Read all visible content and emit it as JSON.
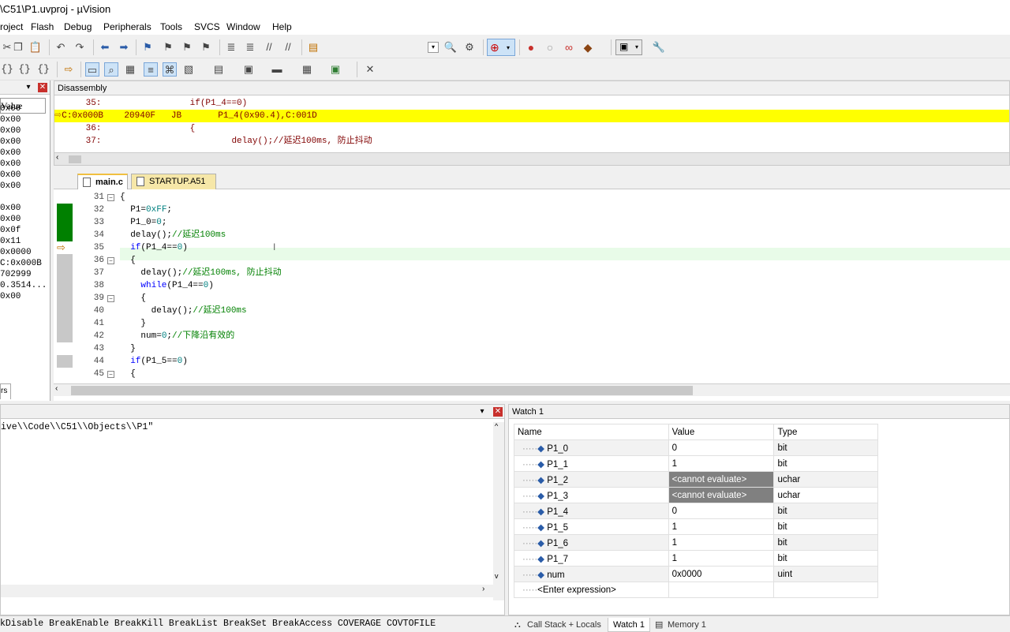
{
  "window": {
    "title": "\\C51\\P1.uvproj - µVision"
  },
  "menu": [
    "roject",
    "Flash",
    "Debug",
    "Peripherals",
    "Tools",
    "SVCS",
    "Window",
    "Help"
  ],
  "left_panel": {
    "header": "Value",
    "values": [
      "0x00",
      "0x00",
      "0x00",
      "0x00",
      "0x00",
      "0x00",
      "0x00",
      "0x00",
      "",
      "0x00",
      "0x00",
      "0x0f",
      "0x11",
      "0x0000",
      "C:0x000B",
      "702999",
      "0.3514...",
      "0x00"
    ],
    "tab": "rs"
  },
  "disassembly": {
    "title": "Disassembly",
    "lines": [
      {
        "text": "    35:                 if(P1_4==0)",
        "current": false
      },
      {
        "text": "C:0x000B    20940F   JB       P1_4(0x90.4),C:001D",
        "current": true
      },
      {
        "text": "    36:                 {",
        "current": false
      },
      {
        "text": "    37:                         delay();//延迟100ms, 防止抖动",
        "current": false
      }
    ]
  },
  "editor": {
    "tabs": [
      "main.c",
      "STARTUP.A51"
    ],
    "lines": [
      {
        "n": "31",
        "code": "{",
        "fold": "-"
      },
      {
        "n": "32",
        "code": "  P1=0xFF;",
        "fold": ""
      },
      {
        "n": "33",
        "code": "  P1_0=0;",
        "fold": ""
      },
      {
        "n": "34",
        "code": "  delay();//延迟100ms",
        "fold": ""
      },
      {
        "n": "35",
        "code": "  if(P1_4==0)",
        "fold": ""
      },
      {
        "n": "36",
        "code": "  {",
        "fold": "-"
      },
      {
        "n": "37",
        "code": "    delay();//延迟100ms, 防止抖动",
        "fold": ""
      },
      {
        "n": "38",
        "code": "    while(P1_4==0)",
        "fold": ""
      },
      {
        "n": "39",
        "code": "    {",
        "fold": "-"
      },
      {
        "n": "40",
        "code": "      delay();//延迟100ms",
        "fold": ""
      },
      {
        "n": "41",
        "code": "    }",
        "fold": ""
      },
      {
        "n": "42",
        "code": "    num=0;//下降沿有效的",
        "fold": ""
      },
      {
        "n": "43",
        "code": "  }",
        "fold": ""
      },
      {
        "n": "44",
        "code": "  if(P1_5==0)",
        "fold": ""
      },
      {
        "n": "45",
        "code": "  {",
        "fold": "-"
      }
    ]
  },
  "command": {
    "output": "ive\\\\Code\\\\C51\\\\Objects\\\\P1\"",
    "bottom": "kDisable BreakEnable BreakKill BreakList BreakSet BreakAccess COVERAGE COVTOFILE"
  },
  "watch": {
    "title": "Watch 1",
    "headers": [
      "Name",
      "Value",
      "Type"
    ],
    "rows": [
      {
        "name": "P1_0",
        "value": "0",
        "type": "bit",
        "error": false
      },
      {
        "name": "P1_1",
        "value": "1",
        "type": "bit",
        "error": false
      },
      {
        "name": "P1_2",
        "value": "<cannot evaluate>",
        "type": "uchar",
        "error": true
      },
      {
        "name": "P1_3",
        "value": "<cannot evaluate>",
        "type": "uchar",
        "error": true
      },
      {
        "name": "P1_4",
        "value": "0",
        "type": "bit",
        "error": false
      },
      {
        "name": "P1_5",
        "value": "1",
        "type": "bit",
        "error": false
      },
      {
        "name": "P1_6",
        "value": "1",
        "type": "bit",
        "error": false
      },
      {
        "name": "P1_7",
        "value": "1",
        "type": "bit",
        "error": false
      },
      {
        "name": "num",
        "value": "0x0000",
        "type": "uint",
        "error": false
      }
    ],
    "enter": "<Enter expression>"
  },
  "bottom_tabs": [
    "Call Stack + Locals",
    "Watch 1",
    "Memory 1"
  ],
  "colors": {
    "current_line": "#ffff00",
    "coverage": "#008000",
    "keyword": "#0000ff",
    "comment": "#008000"
  }
}
